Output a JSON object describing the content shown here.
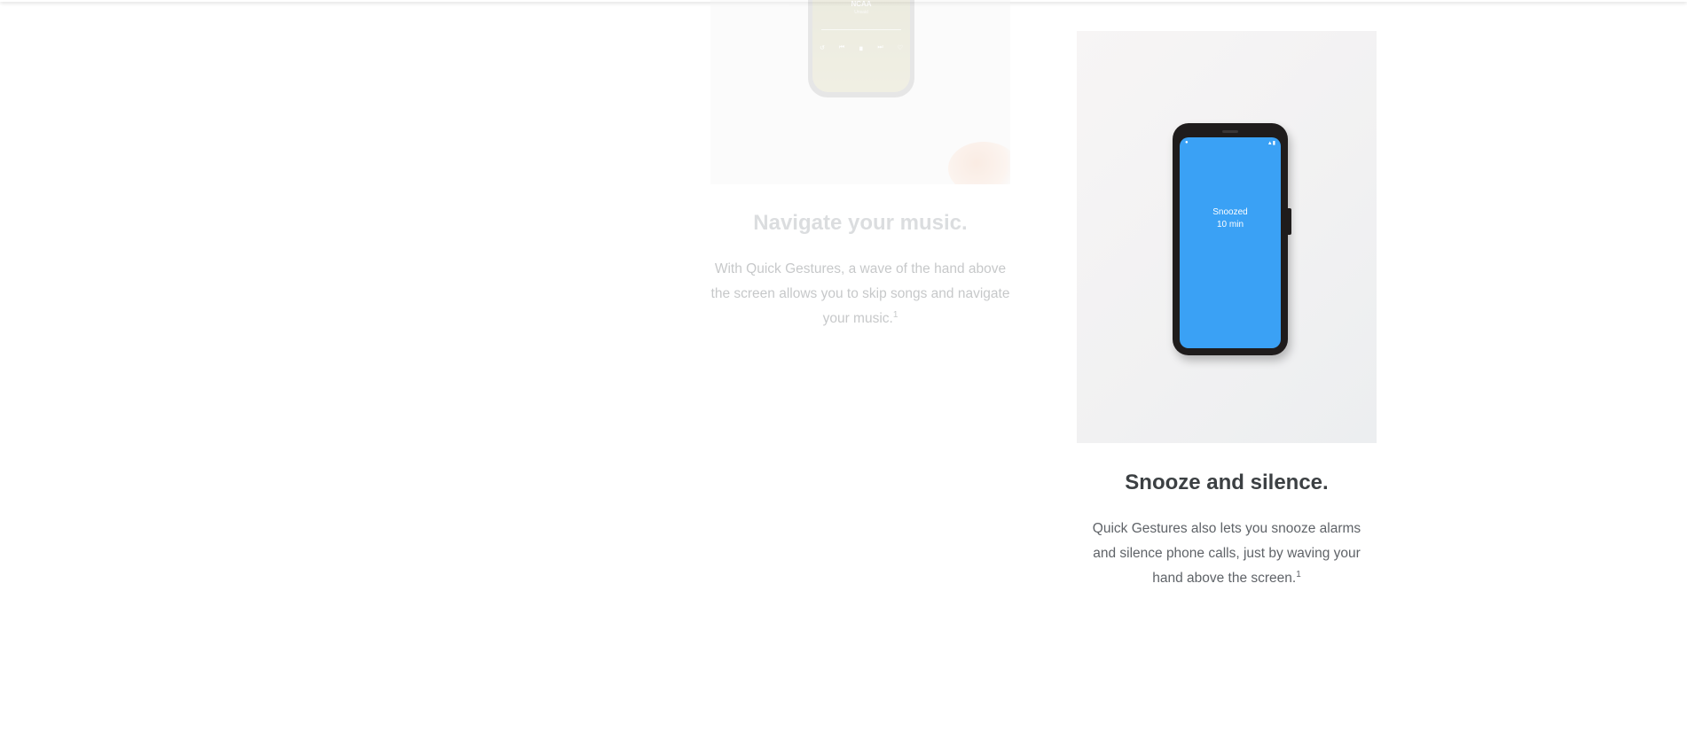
{
  "cards": [
    {
      "id": "navigate-music",
      "title": "Navigate your music.",
      "description": "With Quick Gestures, a wave of the hand above the screen allows you to skip songs and navigate your music.",
      "footnote": "1",
      "screen": {
        "track_title": "NCAA",
        "track_subtitle": "Unsaid",
        "controls": [
          "↺",
          "⏮",
          "⏸",
          "⏭",
          "♡"
        ]
      }
    },
    {
      "id": "snooze-silence",
      "title": "Snooze and silence.",
      "description": "Quick Gestures also lets you snooze alarms and silence phone calls, just by waving your hand above the screen.",
      "footnote": "1",
      "screen": {
        "line1": "Snoozed",
        "line2": "10 min",
        "color": "#3aa1f5"
      }
    }
  ]
}
